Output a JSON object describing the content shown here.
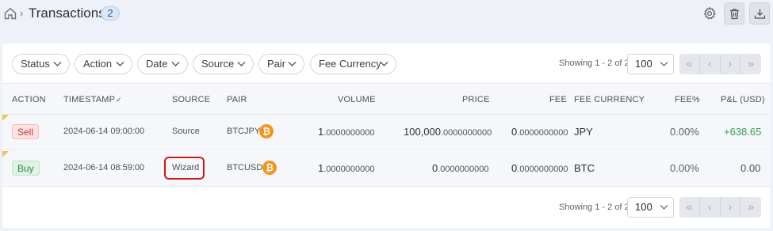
{
  "header": {
    "crumb_separator": "›",
    "title": "Transactions",
    "count": "2",
    "actions": [
      {
        "icon": "gear-icon"
      },
      {
        "icon": "trash-icon"
      },
      {
        "icon": "download-icon"
      }
    ]
  },
  "filters": [
    "Status",
    "Action",
    "Date",
    "Source",
    "Pair",
    "Fee Currency"
  ],
  "pagination": {
    "showing": "Showing 1 - 2 of 2",
    "per_page": "100",
    "buttons": [
      "«",
      "‹",
      "›",
      "»"
    ]
  },
  "table": {
    "columns": [
      "ACTION",
      "TIMESTAMP",
      "SOURCE",
      "PAIR",
      "VOLUME",
      "PRICE",
      "FEE",
      "FEE CURRENCY",
      "FEE%",
      "P&L (USD)"
    ],
    "sort_indicator": "✓",
    "rows": [
      {
        "action": "Sell",
        "timestamp": "2024-06-14 09:00:00",
        "source": "Source",
        "pair": "BTCJPY",
        "coin": "₿",
        "volume_int": "1",
        "volume_dec": ".0000000000",
        "price_int": "100,000",
        "price_dec": ".0000000000",
        "fee_int": "0",
        "fee_dec": ".0000000000",
        "fee_currency": "JPY",
        "fee_pct": "0.00%",
        "pnl": "+638.65"
      },
      {
        "action": "Buy",
        "timestamp": "2024-06-14 08:59:00",
        "source": "Wizard",
        "pair": "BTCUSD",
        "coin": "₿",
        "volume_int": "1",
        "volume_dec": ".0000000000",
        "price_int": "0",
        "price_dec": ".0000000000",
        "fee_int": "0",
        "fee_dec": ".0000000000",
        "fee_currency": "BTC",
        "fee_pct": "0.00%",
        "pnl": "0.00"
      }
    ]
  },
  "colors": {
    "sell": "#c23a3a",
    "buy": "#2c8a45",
    "pnl_positive": "#3a9a55",
    "bitcoin": "#f7931a",
    "highlight": "#d21a1a"
  }
}
